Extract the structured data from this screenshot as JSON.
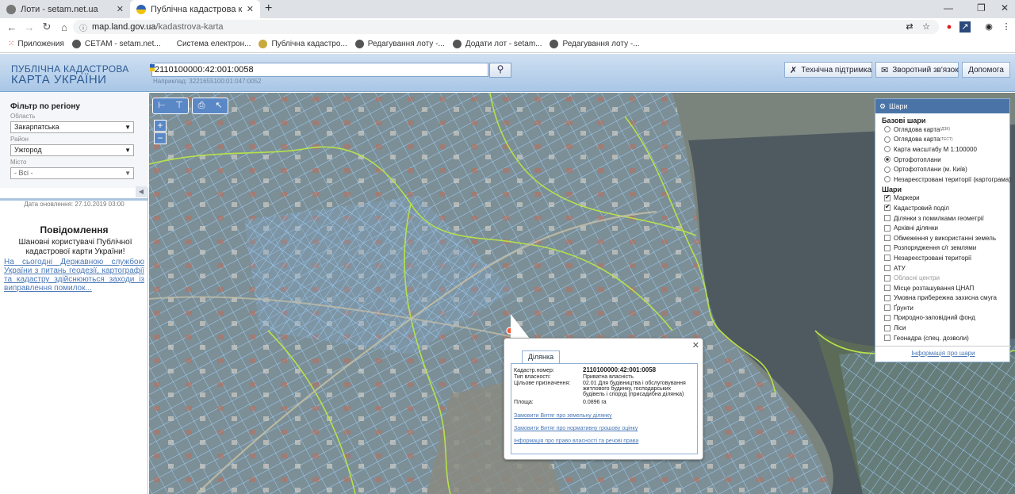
{
  "browser": {
    "tabs": [
      {
        "title": "Лоти - setam.net.ua",
        "icon": "globe-icon"
      },
      {
        "title": "Публічна кадастрова карта Укр",
        "icon": "ukraine-map-icon"
      }
    ],
    "url_host": "map.land.gov.ua",
    "url_path": "/kadastrova-karta",
    "bookmarks": [
      "Приложения",
      "СЕТАМ - setam.net...",
      "Система електрон...",
      "Публічна кадастро...",
      "Редагування лоту -...",
      "Додати лот - setam...",
      "Редагування лоту -..."
    ]
  },
  "header": {
    "logo_line1": "ПУБЛІЧНА КАДАСТРОВА",
    "logo_line2": "КАРТА УКРАЇНИ",
    "search_value": "2110100000:42:001:0058",
    "search_example": "Наприклад: 3221655100:01:047:0052",
    "support": "Технічна підтримка",
    "feedback": "Зворотний зв'язок",
    "help": "Допомога"
  },
  "filter": {
    "title": "Фільтр по регіону",
    "oblast_label": "Область",
    "oblast_value": "Закарпатська",
    "raion_label": "Район",
    "raion_value": "Ужгород",
    "city_label": "Місто",
    "city_value": "- Всі -"
  },
  "updated": "Дата оновлення: 27.10.2019 03:00",
  "messages": {
    "title": "Повідомлення",
    "body": "Шановні користувачі Публічної кадастрової карти України!",
    "link": "На сьогодні Державною службою України з питань геодезії, картографії та кадастру здійснюються заходи із виправлення помилок..."
  },
  "layers": {
    "title": "Шари",
    "base_title": "Базові шари",
    "base": [
      {
        "label": "Оглядова карта",
        "sup": "(ДЗК)",
        "on": false
      },
      {
        "label": "Оглядова карта",
        "sup": "(ТЕСТ)",
        "on": false
      },
      {
        "label": "Карта масштабу М 1:100000",
        "sup": "",
        "on": false
      },
      {
        "label": "Ортофотоплани",
        "sup": "",
        "on": true
      },
      {
        "label": "Ортофотоплани (м. Київ)",
        "sup": "",
        "on": false
      },
      {
        "label": "Незареєстровані території (картограма)",
        "sup": "",
        "on": false
      }
    ],
    "overlay_title": "Шари",
    "overlays": [
      {
        "label": "Маркери",
        "on": true,
        "grey": false
      },
      {
        "label": "Кадастровий поділ",
        "on": true,
        "grey": false
      },
      {
        "label": "Ділянки з помилками геометрії",
        "on": false,
        "grey": false
      },
      {
        "label": "Архівні ділянки",
        "on": false,
        "grey": false
      },
      {
        "label": "Обмеження у використанні земель",
        "on": false,
        "grey": false
      },
      {
        "label": "Розпорядження с/г землями",
        "on": false,
        "grey": false
      },
      {
        "label": "Незареєстровані території",
        "on": false,
        "grey": false
      },
      {
        "label": "АТУ",
        "on": false,
        "grey": false
      },
      {
        "label": "Обласні центри",
        "on": false,
        "grey": true
      },
      {
        "label": "Місце розташування ЦНАП",
        "on": false,
        "grey": false
      },
      {
        "label": "Умовна прибережна захисна смуга",
        "on": false,
        "grey": false
      },
      {
        "label": "Ґрунти",
        "on": false,
        "grey": false
      },
      {
        "label": "Природно-заповідний фонд",
        "on": false,
        "grey": false
      },
      {
        "label": "Ліси",
        "on": false,
        "grey": false
      },
      {
        "label": "Геонадра (спец. дозволи)",
        "on": false,
        "grey": false
      }
    ],
    "info_link": "Інформація про шари"
  },
  "popup": {
    "tab": "Ділянка",
    "cad_label": "Кадастр.номер:",
    "cad_value": "2110100000:42:001:0058",
    "own_label": "Тип власності:",
    "own_value": "Приватна власність",
    "purpose_label": "Цільове призначення:",
    "purpose_value": "02.01 Для будівництва і обслуговування житлового будинку, господарських будівель і споруд (присадибна ділянка)",
    "area_label": "Площа:",
    "area_value": "0.0896 га",
    "link1": "Замовити Витяг про земельну ділянку",
    "link2": "Замовити Витяг про нормативну грошову оцінку",
    "link3": "Інформація про право власності та речові права"
  }
}
